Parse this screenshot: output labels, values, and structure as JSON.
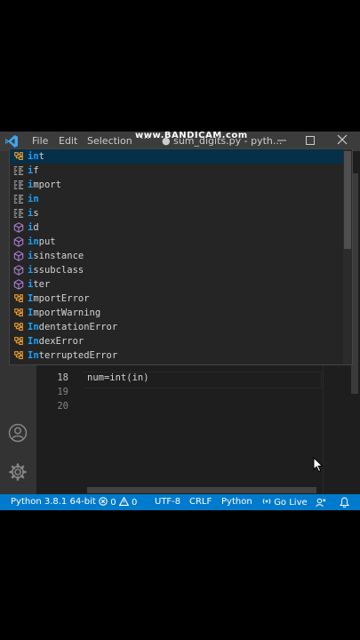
{
  "window": {
    "title": "● sum_digits.py - pyth...",
    "watermark": "www.BANDICAM.com"
  },
  "menu": {
    "file": "File",
    "edit": "Edit",
    "selection": "Selection",
    "more": "···"
  },
  "editor": {
    "lines": [
      {
        "number": "18",
        "code": "num=int(in)"
      },
      {
        "number": "19",
        "code": ""
      },
      {
        "number": "20",
        "code": ""
      }
    ]
  },
  "suggestions": [
    {
      "label": "int",
      "match": "in",
      "rest": "t",
      "icon": "class-icon",
      "kind": "class"
    },
    {
      "label": "if",
      "match": "i",
      "rest": "f",
      "icon": "snippet-icon",
      "kind": "keyword"
    },
    {
      "label": "import",
      "match": "i",
      "rest": "mport",
      "icon": "snippet-icon",
      "kind": "keyword"
    },
    {
      "label": "in",
      "match": "in",
      "rest": "",
      "icon": "snippet-icon",
      "kind": "keyword"
    },
    {
      "label": "is",
      "match": "i",
      "rest": "s",
      "icon": "snippet-icon",
      "kind": "keyword"
    },
    {
      "label": "id",
      "match": "i",
      "rest": "d",
      "icon": "function-icon",
      "kind": "function"
    },
    {
      "label": "input",
      "match": "in",
      "rest": "put",
      "icon": "function-icon",
      "kind": "function"
    },
    {
      "label": "isinstance",
      "match": "i",
      "rest": "sinstance",
      "icon": "function-icon",
      "kind": "function"
    },
    {
      "label": "issubclass",
      "match": "i",
      "rest": "ssubclass",
      "icon": "function-icon",
      "kind": "function"
    },
    {
      "label": "iter",
      "match": "i",
      "rest": "ter",
      "icon": "function-icon",
      "kind": "function"
    },
    {
      "label": "ImportError",
      "match": "I",
      "rest": "mportError",
      "icon": "class-icon",
      "kind": "class"
    },
    {
      "label": "ImportWarning",
      "match": "I",
      "rest": "mportWarning",
      "icon": "class-icon",
      "kind": "class"
    },
    {
      "label": "IndentationError",
      "match": "In",
      "rest": "dentationError",
      "icon": "class-icon",
      "kind": "class"
    },
    {
      "label": "IndexError",
      "match": "In",
      "rest": "dexError",
      "icon": "class-icon",
      "kind": "class"
    },
    {
      "label": "InterruptedError",
      "match": "In",
      "rest": "terruptedError",
      "icon": "class-icon",
      "kind": "class"
    }
  ],
  "status": {
    "python": "Python 3.8.1 64-bit",
    "errors": "0",
    "warnings": "0",
    "encoding": "UTF-8",
    "eol": "CRLF",
    "language": "Python",
    "golive": "Go Live"
  },
  "colors": {
    "accent": "#007acc",
    "match": "#18a3ff",
    "class_icon": "#ee9d28",
    "function_icon": "#b180d7",
    "snippet_icon": "#c5c5c5"
  }
}
